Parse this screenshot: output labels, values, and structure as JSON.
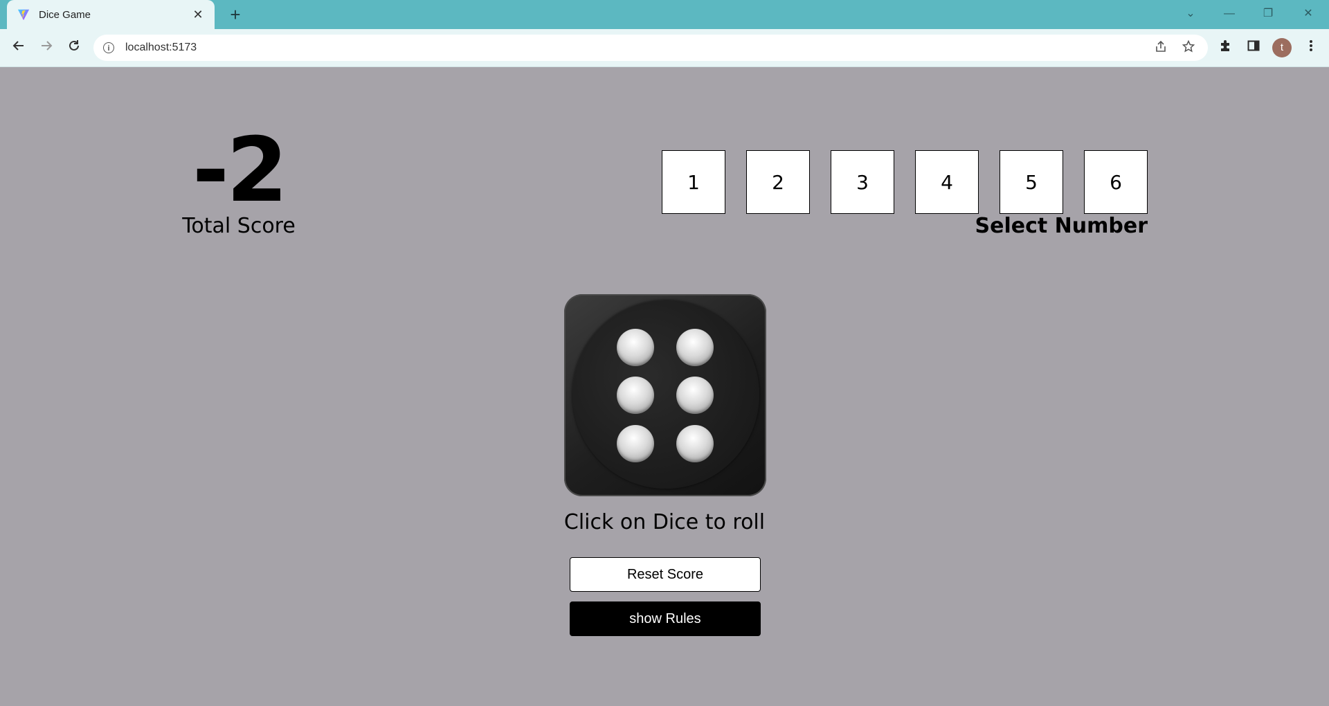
{
  "browser": {
    "tab_title": "Dice Game",
    "tab_close": "✕",
    "new_tab": "+",
    "url": "localhost:5173",
    "avatar_letter": "t",
    "window_controls": {
      "dropdown": "⌄",
      "minimize": "—",
      "restore": "❐",
      "close": "✕"
    }
  },
  "game": {
    "total_score": "-2",
    "total_score_label": "Total Score",
    "numbers": [
      "1",
      "2",
      "3",
      "4",
      "5",
      "6"
    ],
    "select_label": "Select Number",
    "dice_value": 6,
    "dice_hint": "Click on Dice to roll",
    "reset_button": "Reset Score",
    "rules_button": "show Rules"
  },
  "colors": {
    "page_bg": "#a6a3a9",
    "tabbar_bg": "#5cb8c1",
    "toolbar_bg": "#e8f5f6"
  }
}
